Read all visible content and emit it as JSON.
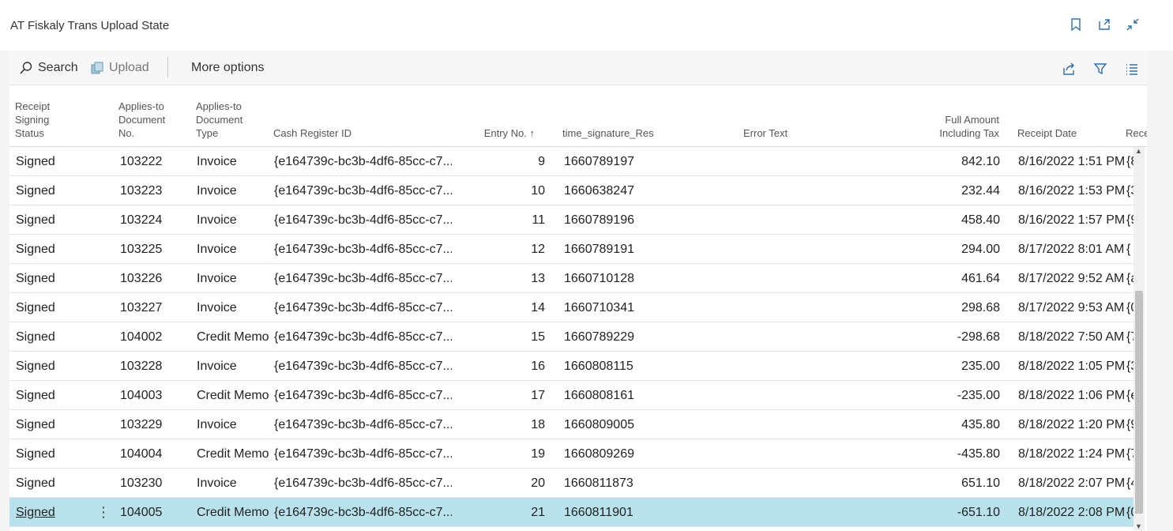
{
  "page": {
    "title": "AT Fiskaly Trans Upload State"
  },
  "title_actions": {
    "bookmark": "bookmark-icon",
    "open_new": "open-in-new-window-icon",
    "collapse": "collapse-icon"
  },
  "toolbar": {
    "search_label": "Search",
    "upload_label": "Upload",
    "more_options_label": "More options",
    "right_icons": [
      "share-icon",
      "filter-icon",
      "list-view-icon"
    ]
  },
  "columns": {
    "receipt_signing_status": "Receipt Signing Status",
    "applies_to_document_no": "Applies-to Document No.",
    "applies_to_document_type": "Applies-to Document Type",
    "cash_register_id": "Cash Register ID",
    "entry_no": "Entry No.",
    "entry_no_sort": "↑",
    "time_signature_res": "time_signature_Res",
    "error_text": "Error Text",
    "full_amount_including_tax": "Full Amount Including Tax",
    "receipt_date": "Receipt Date",
    "receipt_partial": "Rece"
  },
  "rows": [
    {
      "status": "Signed",
      "doc_no": "103222",
      "doc_type": "Invoice",
      "cash_register_id": "{e164739c-bc3b-4df6-85cc-c7...",
      "entry_no": "9",
      "time_signature": "1660789197",
      "error_text": "",
      "amount": "842.10",
      "receipt_date": "8/16/2022 1:51 PM",
      "trail": "{8"
    },
    {
      "status": "Signed",
      "doc_no": "103223",
      "doc_type": "Invoice",
      "cash_register_id": "{e164739c-bc3b-4df6-85cc-c7...",
      "entry_no": "10",
      "time_signature": "1660638247",
      "error_text": "",
      "amount": "232.44",
      "receipt_date": "8/16/2022 1:53 PM",
      "trail": "{3"
    },
    {
      "status": "Signed",
      "doc_no": "103224",
      "doc_type": "Invoice",
      "cash_register_id": "{e164739c-bc3b-4df6-85cc-c7...",
      "entry_no": "11",
      "time_signature": "1660789196",
      "error_text": "",
      "amount": "458.40",
      "receipt_date": "8/16/2022 1:57 PM",
      "trail": "{9"
    },
    {
      "status": "Signed",
      "doc_no": "103225",
      "doc_type": "Invoice",
      "cash_register_id": "{e164739c-bc3b-4df6-85cc-c7...",
      "entry_no": "12",
      "time_signature": "1660789191",
      "error_text": "",
      "amount": "294.00",
      "receipt_date": "8/17/2022 8:01 AM",
      "trail": "{"
    },
    {
      "status": "Signed",
      "doc_no": "103226",
      "doc_type": "Invoice",
      "cash_register_id": "{e164739c-bc3b-4df6-85cc-c7...",
      "entry_no": "13",
      "time_signature": "1660710128",
      "error_text": "",
      "amount": "461.64",
      "receipt_date": "8/17/2022 9:52 AM",
      "trail": "{a"
    },
    {
      "status": "Signed",
      "doc_no": "103227",
      "doc_type": "Invoice",
      "cash_register_id": "{e164739c-bc3b-4df6-85cc-c7...",
      "entry_no": "14",
      "time_signature": "1660710341",
      "error_text": "",
      "amount": "298.68",
      "receipt_date": "8/17/2022 9:53 AM",
      "trail": "{0"
    },
    {
      "status": "Signed",
      "doc_no": "104002",
      "doc_type": "Credit Memo",
      "cash_register_id": "{e164739c-bc3b-4df6-85cc-c7...",
      "entry_no": "15",
      "time_signature": "1660789229",
      "error_text": "",
      "amount": "-298.68",
      "receipt_date": "8/18/2022 7:50 AM",
      "trail": "{7"
    },
    {
      "status": "Signed",
      "doc_no": "103228",
      "doc_type": "Invoice",
      "cash_register_id": "{e164739c-bc3b-4df6-85cc-c7...",
      "entry_no": "16",
      "time_signature": "1660808115",
      "error_text": "",
      "amount": "235.00",
      "receipt_date": "8/18/2022 1:05 PM",
      "trail": "{3"
    },
    {
      "status": "Signed",
      "doc_no": "104003",
      "doc_type": "Credit Memo",
      "cash_register_id": "{e164739c-bc3b-4df6-85cc-c7...",
      "entry_no": "17",
      "time_signature": "1660808161",
      "error_text": "",
      "amount": "-235.00",
      "receipt_date": "8/18/2022 1:06 PM",
      "trail": "{e"
    },
    {
      "status": "Signed",
      "doc_no": "103229",
      "doc_type": "Invoice",
      "cash_register_id": "{e164739c-bc3b-4df6-85cc-c7...",
      "entry_no": "18",
      "time_signature": "1660809005",
      "error_text": "",
      "amount": "435.80",
      "receipt_date": "8/18/2022 1:20 PM",
      "trail": "{9"
    },
    {
      "status": "Signed",
      "doc_no": "104004",
      "doc_type": "Credit Memo",
      "cash_register_id": "{e164739c-bc3b-4df6-85cc-c7...",
      "entry_no": "19",
      "time_signature": "1660809269",
      "error_text": "",
      "amount": "-435.80",
      "receipt_date": "8/18/2022 1:24 PM",
      "trail": "{7"
    },
    {
      "status": "Signed",
      "doc_no": "103230",
      "doc_type": "Invoice",
      "cash_register_id": "{e164739c-bc3b-4df6-85cc-c7...",
      "entry_no": "20",
      "time_signature": "1660811873",
      "error_text": "",
      "amount": "651.10",
      "receipt_date": "8/18/2022 2:07 PM",
      "trail": "{4"
    },
    {
      "status": "Signed",
      "doc_no": "104005",
      "doc_type": "Credit Memo",
      "cash_register_id": "{e164739c-bc3b-4df6-85cc-c7...",
      "entry_no": "21",
      "time_signature": "1660811901",
      "error_text": "",
      "amount": "-651.10",
      "receipt_date": "8/18/2022 2:08 PM",
      "trail": "{0",
      "selected": true
    }
  ],
  "row_actions": {
    "menu": "⋮"
  },
  "colors": {
    "selected_row": "#b9e2ec",
    "header_text": "#555555",
    "accent": "#0078d4"
  }
}
